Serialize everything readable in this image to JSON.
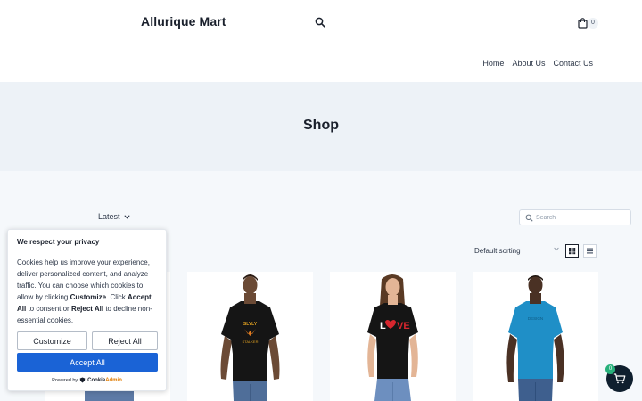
{
  "header": {
    "site_title": "Allurique Mart",
    "cart_count": "0",
    "nav": [
      "Home",
      "About Us",
      "Contact Us"
    ]
  },
  "hero": {
    "title": "Shop"
  },
  "shop": {
    "filter_label": "Latest",
    "search_placeholder": "Search",
    "sort_label": "Default sorting",
    "products": [
      {
        "shirt_color": "#151515",
        "print": "eagle"
      },
      {
        "shirt_color": "#151515",
        "print": "love"
      },
      {
        "shirt_color": "#1f8fc7",
        "print": "text"
      }
    ]
  },
  "cookie": {
    "title": "We respect your privacy",
    "body_1": "Cookies help us improve your experience, deliver personalized content, and analyze traffic. You can choose which cookies to allow by clicking ",
    "body_customize": "Customize",
    "body_2": ". Click ",
    "body_accept": "Accept All",
    "body_3": " to consent or ",
    "body_reject": "Reject All",
    "body_4": " to decline non-essential cookies.",
    "customize_label": "Customize",
    "reject_label": "Reject All",
    "accept_label": "Accept All",
    "powered_by": "Powered by",
    "brand_cookie": "Cookie",
    "brand_admin": "Admin"
  },
  "floating_cart": {
    "count": "0"
  },
  "colors": {
    "accent": "#1a63d6",
    "badge": "#27b07a"
  }
}
